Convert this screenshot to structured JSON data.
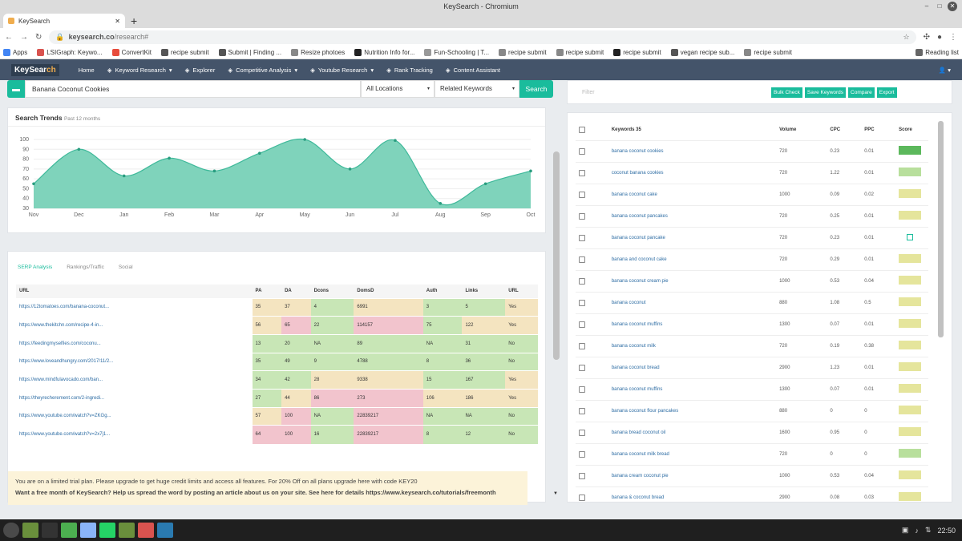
{
  "window_title": "KeySearch - Chromium",
  "tab_title": "KeySearch",
  "url_host": "keysearch.co",
  "url_path": "/research#",
  "bookmarks": [
    "Apps",
    "LSIGraph: Keywo...",
    "ConvertKit",
    "recipe submit",
    "Submit | Finding ...",
    "Resize photoes",
    "Nutrition Info for...",
    "Fun-Schooling | T...",
    "recipe submit",
    "recipe submit",
    "recipe submit",
    "vegan recipe sub...",
    "recipe submit",
    "Reading list"
  ],
  "nav": {
    "logo_a": "KeySear",
    "logo_b": "ch",
    "items": [
      "Home",
      "Keyword Research",
      "Explorer",
      "Competitive Analysis",
      "Youtube Research",
      "Rank Tracking",
      "Content Assistant"
    ]
  },
  "search": {
    "keyword": "Banana Coconut Cookies",
    "location": "All Locations",
    "type": "Related Keywords",
    "button": "Search"
  },
  "trends": {
    "title": "Search Trends",
    "subtitle": "Past 12 months"
  },
  "chart_data": {
    "type": "area",
    "x": [
      "Nov",
      "Dec",
      "Jan",
      "Feb",
      "Mar",
      "Apr",
      "May",
      "Jun",
      "Jul",
      "Aug",
      "Sep",
      "Oct"
    ],
    "values": [
      55,
      90,
      63,
      81,
      68,
      86,
      100,
      70,
      99,
      35,
      55,
      68
    ],
    "ylim": [
      30,
      100
    ],
    "yticks": [
      100,
      90,
      80,
      70,
      60,
      50,
      40,
      30
    ],
    "color": "#7fd3bb"
  },
  "serp": {
    "tabs": [
      "SERP Analysis",
      "Rankings/Traffic",
      "Social"
    ],
    "headers": [
      "URL",
      "PA",
      "DA",
      "Dcons",
      "DomsD",
      "Auth",
      "Links",
      "URL"
    ],
    "rows": [
      [
        "https://12tomatoes.com/banana-coconut...",
        "35",
        "37",
        "4",
        "6991",
        "3",
        "5",
        "Yes"
      ],
      [
        "https://www.thekitchn.com/recipe-4-in...",
        "56",
        "65",
        "22",
        "114157",
        "75",
        "122",
        "Yes"
      ],
      [
        "https://feedingmyselfies.com/coconu...",
        "13",
        "20",
        "NA",
        "89",
        "NA",
        "31",
        "No"
      ],
      [
        "https://www.loveandhungry.com/2017/11/2...",
        "35",
        "49",
        "9",
        "4788",
        "8",
        "36",
        "No"
      ],
      [
        "https://www.mindfulavocado.com/ban...",
        "34",
        "42",
        "28",
        "9338",
        "15",
        "167",
        "Yes"
      ],
      [
        "https://theyrecherement.com/2-ingredi...",
        "27",
        "44",
        "86",
        "273",
        "106",
        "186",
        "Yes"
      ],
      [
        "https://www.youtube.com/watch?v=ZKGg...",
        "57",
        "100",
        "NA",
        "22839217",
        "NA",
        "NA",
        "No"
      ],
      [
        "https://www.youtube.com/watch?v=2x7j1...",
        "64",
        "100",
        "16",
        "22839217",
        "8",
        "12",
        "No"
      ]
    ],
    "colors": [
      [
        "y",
        "y",
        "g",
        "y",
        "g",
        "g",
        "y"
      ],
      [
        "y",
        "r",
        "g",
        "r",
        "g",
        "y",
        "y"
      ],
      [
        "g",
        "g",
        "g",
        "g",
        "g",
        "g",
        "g"
      ],
      [
        "g",
        "g",
        "g",
        "g",
        "g",
        "g",
        "g"
      ],
      [
        "g",
        "g",
        "y",
        "y",
        "g",
        "g",
        "y"
      ],
      [
        "g",
        "y",
        "r",
        "r",
        "y",
        "y",
        "y"
      ],
      [
        "y",
        "r",
        "g",
        "r",
        "g",
        "g",
        "g"
      ],
      [
        "r",
        "r",
        "g",
        "r",
        "g",
        "g",
        "g"
      ]
    ]
  },
  "right": {
    "filter": "Filter",
    "buttons": [
      "Bulk Check",
      "Save Keywords",
      "Compare",
      "Export"
    ],
    "headers": [
      "Keywords 35",
      "Volume",
      "CPC",
      "PPC",
      "Score"
    ],
    "rows": [
      [
        "banana coconut cookies",
        "720",
        "0.23",
        "0.01",
        "#5cb85c"
      ],
      [
        "coconut banana cookies",
        "720",
        "1.22",
        "0.01",
        "#b8df9c"
      ],
      [
        "banana coconut cake",
        "1000",
        "0.09",
        "0.02",
        "#e5e59c"
      ],
      [
        "banana coconut pancakes",
        "720",
        "0.25",
        "0.01",
        "#e5e59c"
      ],
      [
        "banana coconut pancake",
        "720",
        "0.23",
        "0.01",
        ""
      ],
      [
        "banana and coconut cake",
        "720",
        "0.29",
        "0.01",
        "#e5e59c"
      ],
      [
        "banana coconut cream pie",
        "1000",
        "0.53",
        "0.04",
        "#e5e59c"
      ],
      [
        "banana coconut",
        "880",
        "1.08",
        "0.5",
        "#e5e59c"
      ],
      [
        "banana coconut muffins",
        "1300",
        "0.07",
        "0.01",
        "#e5e59c"
      ],
      [
        "banana coconut milk",
        "720",
        "0.19",
        "0.38",
        "#e5e59c"
      ],
      [
        "banana coconut bread",
        "2900",
        "1.23",
        "0.01",
        "#e5e59c"
      ],
      [
        "banana coconut muffins",
        "1300",
        "0.07",
        "0.01",
        "#e5e59c"
      ],
      [
        "banana coconut flour pancakes",
        "880",
        "0",
        "0",
        "#e5e59c"
      ],
      [
        "banana bread coconut oil",
        "1600",
        "0.95",
        "0",
        "#e5e59c"
      ],
      [
        "banana coconut milk bread",
        "720",
        "0",
        "0",
        "#b8df9c"
      ],
      [
        "banana cream coconut pie",
        "1000",
        "0.53",
        "0.04",
        "#e5e59c"
      ],
      [
        "banana & coconut bread",
        "2900",
        "0.08",
        "0.03",
        "#e5e59c"
      ]
    ]
  },
  "notice": {
    "line1": "You are on a limited trial plan. Please upgrade to get huge credit limits and access all features. For 20% Off on all plans upgrade here with code KEY20",
    "line2": "Want a free month of KeySearch? Help us spread the word by posting an article about us on your site. See here for details https://www.keysearch.co/tutorials/freemonth"
  },
  "clock": "22:50"
}
